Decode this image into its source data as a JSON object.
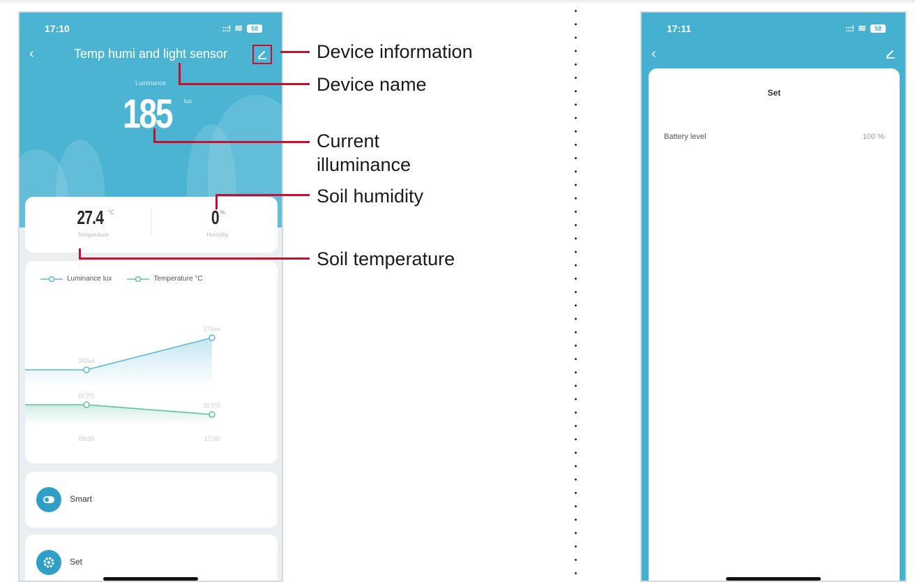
{
  "phone1": {
    "status_time": "17:10",
    "status_signal": ":::!",
    "status_wifi": "≋",
    "battery": "58",
    "title": "Temp humi and light sensor",
    "luminance_label": "Luminance",
    "luminance_value": "185",
    "luminance_unit": "lux",
    "temperature_value": "27.4",
    "temperature_unit": "°C",
    "temperature_label": "Temperature",
    "humidity_value": "0",
    "humidity_unit": "%",
    "humidity_label": "Humidity",
    "smart_label": "Smart",
    "set_label": "Set"
  },
  "phone2": {
    "status_time": "17:11",
    "status_signal": ":::!",
    "status_wifi": "≋",
    "battery": "58",
    "sheet_title": "Set",
    "battery_level_label": "Battery level",
    "battery_level_value": "100 %"
  },
  "callouts": {
    "device_information": "Device information",
    "device_name": "Device name",
    "current_illuminance_1": "Current",
    "current_illuminance_2": "illuminance",
    "soil_humidity": "Soil humidity",
    "soil_temperature": "Soil temperature"
  },
  "colors": {
    "header_blue": "#4cb4d3",
    "leader_red": "#c8102e",
    "luminance_line": "#5bb8d6",
    "temperature_line": "#5cc0a2"
  },
  "chart_data": {
    "type": "line",
    "x": [
      "09:00",
      "17:00"
    ],
    "series": [
      {
        "name": "Luminance lux",
        "values": [
          202,
          271
        ],
        "labels": [
          "202lux",
          "271lux"
        ]
      },
      {
        "name": "Temperature °C",
        "values": [
          23.3,
          20.5
        ],
        "labels": [
          "23.3°C",
          "20.5°C"
        ]
      }
    ],
    "legend_position": "top-left"
  }
}
